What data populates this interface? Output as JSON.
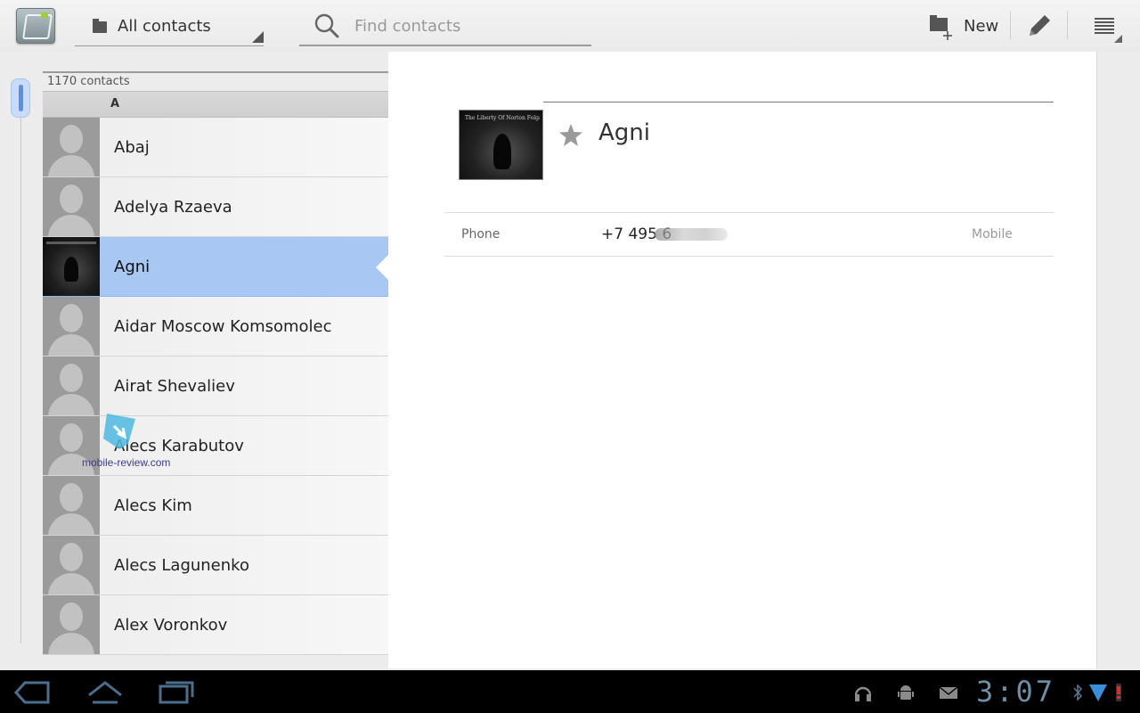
{
  "actionbar": {
    "filter_label": "All contacts",
    "search_placeholder": "Find contacts",
    "new_label": "New"
  },
  "list": {
    "count_label": "1170 contacts",
    "section_letter": "A",
    "contacts": [
      {
        "name": "Abaj",
        "photo": false
      },
      {
        "name": "Adelya Rzaeva",
        "photo": false
      },
      {
        "name": "Agni",
        "photo": true,
        "selected": true
      },
      {
        "name": "Aidar Moscow Komsomolec",
        "photo": false
      },
      {
        "name": "Airat Shevaliev",
        "photo": false
      },
      {
        "name": "Alecs Karabutov",
        "photo": false
      },
      {
        "name": "Alecs Kim",
        "photo": false
      },
      {
        "name": "Alecs Lagunenko",
        "photo": false
      },
      {
        "name": "Alex Voronkov",
        "photo": false
      }
    ]
  },
  "watermark": {
    "text": "mobile-review.com"
  },
  "detail": {
    "name": "Agni",
    "photo_caption": "The Liberty Of Norton Folgate",
    "phone": {
      "kind_label": "Phone",
      "value": "+7 495 6",
      "type_label": "Mobile"
    }
  },
  "systembar": {
    "clock": "3:07"
  },
  "colors": {
    "selection": "#a8c8f3",
    "accent_blue": "#5b8fe3",
    "clock": "#6d8fa6"
  }
}
